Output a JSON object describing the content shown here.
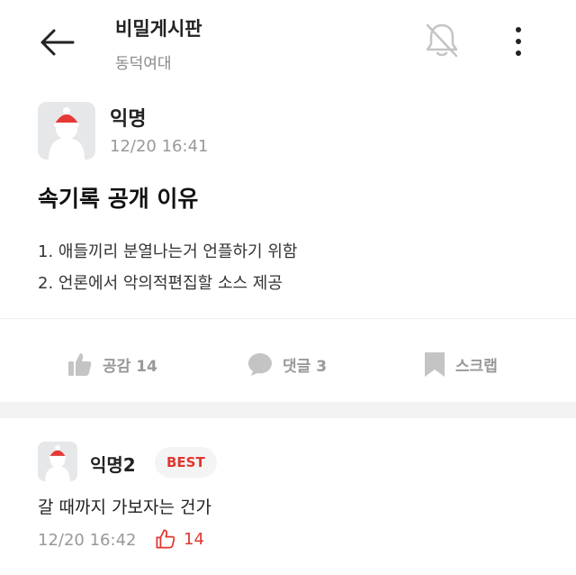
{
  "header": {
    "title": "비밀게시판",
    "subtitle": "동덕여대",
    "icons": {
      "back": "arrow-left-icon",
      "notification": "bell-muted-icon",
      "more": "more-vertical-icon"
    }
  },
  "post": {
    "author": "익명",
    "time": "12/20 16:41",
    "title": "속기록 공개 이유",
    "body": [
      "1. 애들끼리 분열나는거 언플하기 위함",
      "2. 언론에서 악의적편집할 소스 제공"
    ]
  },
  "actions": {
    "like_label": "공감 14",
    "comment_label": "댓글 3",
    "scrap_label": "스크랩"
  },
  "comment": {
    "author": "익명2",
    "badge": "BEST",
    "text": "갈 때까지 가보자는 건가",
    "time": "12/20 16:42",
    "likes": "14"
  },
  "colors": {
    "accent": "#e0362f",
    "muted_text": "#999999",
    "icon_gray": "#c4c4c4",
    "background": "#ffffff"
  }
}
